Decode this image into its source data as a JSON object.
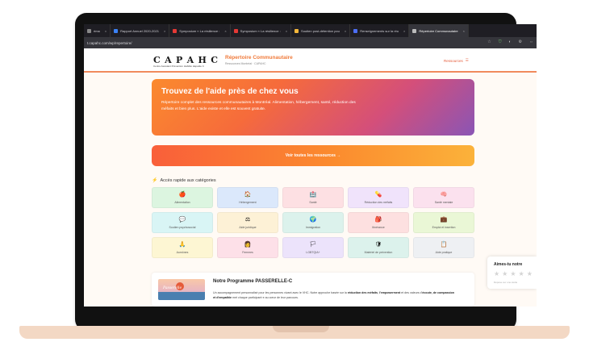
{
  "browser": {
    "tabs": [
      {
        "label": "rima",
        "color": "#888888",
        "active": false
      },
      {
        "label": "Rapport Annuel 2020-2021",
        "color": "#3b82f6",
        "active": false
      },
      {
        "label": "Symposium « La résilience :",
        "color": "#e53935",
        "active": false
      },
      {
        "label": "Symposium « La résilience :",
        "color": "#e53935",
        "active": false
      },
      {
        "label": "Soutien post-détention pou",
        "color": "#f5b73b",
        "active": false
      },
      {
        "label": "Renseignements sur la réu",
        "color": "#4c6ef5",
        "active": false
      },
      {
        "label": "Répertoire Communautaire",
        "color": "#bbbbbb",
        "active": true
      }
    ],
    "url": "t.capahc.com/wp/repertoire/"
  },
  "header": {
    "logo_letters": [
      "C",
      "A",
      "P",
      "A",
      "H",
      "C"
    ],
    "logo_sub": "Centre Assistant Prévention Habilité Hépatite C",
    "site_title": "Répertoire Communautaire",
    "site_sub": "Ressources Montréal · CAPAHC",
    "resources_label": "Ressources",
    "menu_icon": "☰"
  },
  "hero": {
    "title": "Trouvez de l'aide près de chez vous",
    "text": "Répertoire complet des ressources communautaires à Montréal. Alimentation, hébergement, santé, réduction des méfaits et bien plus. L'aide existe et elle est souvent gratuite."
  },
  "all_button": "Voir toutes les ressources →",
  "quick_access": {
    "icon": "⚡",
    "title": "Accès rapide aux catégories"
  },
  "categories": [
    {
      "label": "Alimentation",
      "icon": "🍎",
      "bg": "#dcf5e0"
    },
    {
      "label": "Hébergement",
      "icon": "🏠",
      "bg": "#dbe8fb"
    },
    {
      "label": "Santé",
      "icon": "🏥",
      "bg": "#fde0e3"
    },
    {
      "label": "Réduction des méfaits",
      "icon": "💊",
      "bg": "#f0e3fb"
    },
    {
      "label": "Santé mentale",
      "icon": "🧠",
      "bg": "#fbe1ee"
    },
    {
      "label": "Soutien psychosocial",
      "icon": "💬",
      "bg": "#d9f5f5"
    },
    {
      "label": "Aide juridique",
      "icon": "⚖",
      "bg": "#fdf1d6"
    },
    {
      "label": "Immigration",
      "icon": "🌍",
      "bg": "#dcf2ec"
    },
    {
      "label": "Itinérance",
      "icon": "🎒",
      "bg": "#fde0e0"
    },
    {
      "label": "Emploi et insertion",
      "icon": "💼",
      "bg": "#eaf7d6"
    },
    {
      "label": "Aumônes",
      "icon": "🙏",
      "bg": "#fdf6d3"
    },
    {
      "label": "Femmes",
      "icon": "👩",
      "bg": "#fde0e8"
    },
    {
      "label": "LGBTQIA+",
      "icon": "🏳",
      "bg": "#ece3fb"
    },
    {
      "label": "Matériel de prévention",
      "icon": "🛡",
      "bg": "#dcf2ec"
    },
    {
      "label": "Aide pratique",
      "icon": "📋",
      "bg": "#eef0f3"
    }
  ],
  "program": {
    "image_word": "Passerelle",
    "title": "Notre Programme PASSERELLE-C",
    "text_1": "Un accompagnement personnalisé pour les personnes vivant avec le VHC. Notre approche basée sur la ",
    "bold_1": "réduction des méfaits",
    "text_2": ", ",
    "bold_2": "l'empowerment",
    "text_3": " et des valeurs d'",
    "bold_3": "écoute, de compassion et d'empathie",
    "text_4": " met chaque participant·e au cœur de leur parcours."
  },
  "rating": {
    "title": "Aimes-tu notre",
    "stars": 5,
    "sub": "Dépose sur une étoile"
  }
}
